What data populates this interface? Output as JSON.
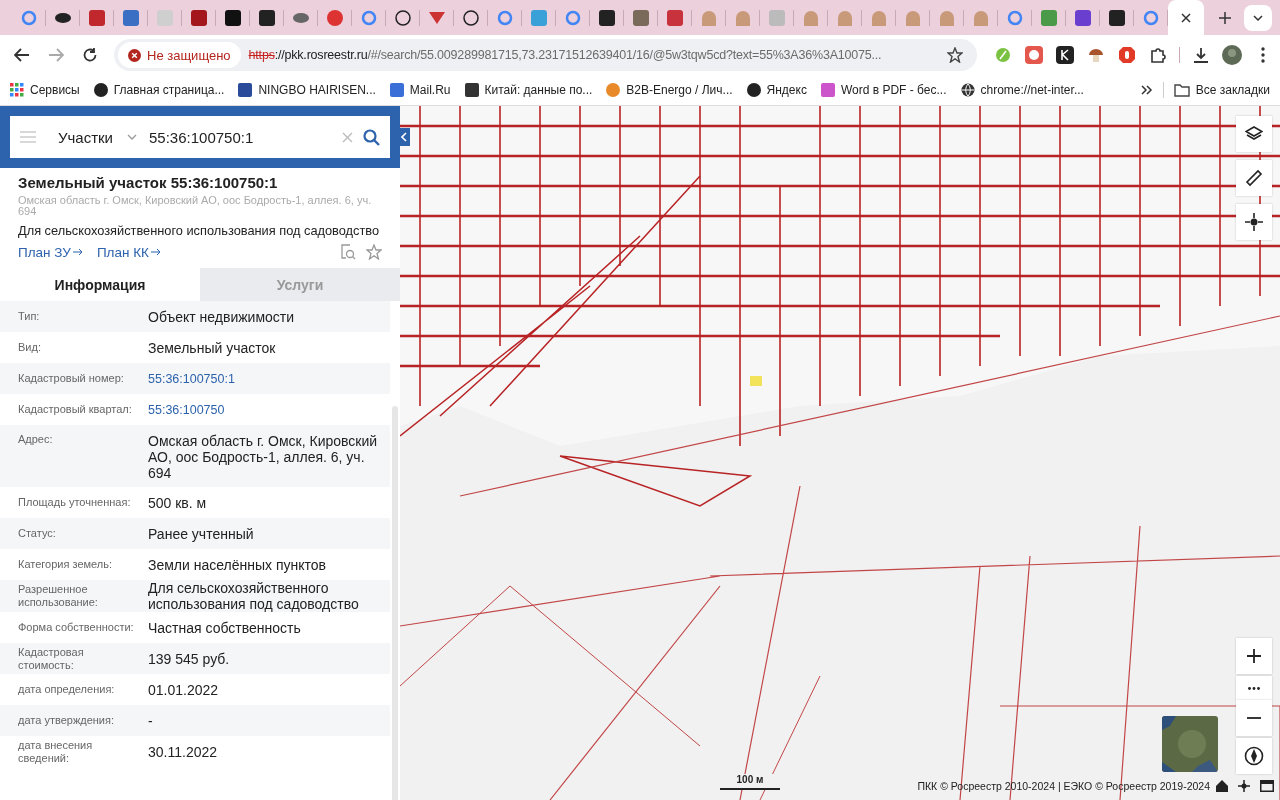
{
  "browser": {
    "tabs": [
      {
        "selected": false
      },
      {
        "selected": false
      },
      {
        "selected": false
      },
      {
        "selected": false
      },
      {
        "selected": false
      },
      {
        "selected": false
      },
      {
        "selected": false
      },
      {
        "selected": false
      },
      {
        "selected": false
      },
      {
        "selected": false
      },
      {
        "selected": false
      },
      {
        "selected": false
      },
      {
        "selected": false
      },
      {
        "selected": false
      },
      {
        "selected": false
      },
      {
        "selected": false
      },
      {
        "selected": false
      },
      {
        "selected": false
      },
      {
        "selected": false
      },
      {
        "selected": false
      },
      {
        "selected": false
      },
      {
        "selected": false
      },
      {
        "selected": false
      },
      {
        "selected": false
      },
      {
        "selected": false
      },
      {
        "selected": false
      },
      {
        "selected": false
      },
      {
        "selected": false
      },
      {
        "selected": false
      },
      {
        "selected": false
      },
      {
        "selected": false
      },
      {
        "selected": false
      },
      {
        "selected": false
      },
      {
        "selected": false
      },
      {
        "selected": true
      }
    ],
    "security_label": "Не защищено",
    "url": {
      "scheme": "https",
      "host": "://pkk.rosreestr.ru",
      "path": "/#/search/55.009289981715,73.23171512639401/16/@5w3tqw5cd?text=55%3A36%3A10075..."
    },
    "bookmarks": [
      {
        "label": "Сервисы"
      },
      {
        "label": "Главная страница..."
      },
      {
        "label": "NINGBO HAIRISEN..."
      },
      {
        "label": "Mail.Ru"
      },
      {
        "label": "Китай: данные по..."
      },
      {
        "label": "B2B-Energo / Лич..."
      },
      {
        "label": "Яндекс"
      },
      {
        "label": "Word в PDF - бес..."
      },
      {
        "label": "chrome://net-inter..."
      }
    ],
    "all_bookmarks": "Все закладки"
  },
  "search": {
    "category": "Участки",
    "value": "55:36:100750:1"
  },
  "parcel": {
    "title": "Земельный участок 55:36:100750:1",
    "address": "Омская область г. Омск, Кировский АО, оос Бодрость-1, аллея. 6, уч. 694",
    "purpose": "Для сельскохозяйственного использования под садоводство",
    "links": [
      "План ЗУ",
      "План КК"
    ]
  },
  "panel_tabs": [
    {
      "label": "Информация",
      "selected": true
    },
    {
      "label": "Услуги",
      "selected": false
    }
  ],
  "info_rows": [
    {
      "label": "Тип:",
      "value": "Объект недвижимости",
      "kind": "text"
    },
    {
      "label": "Вид:",
      "value": "Земельный участок",
      "kind": "text"
    },
    {
      "label": "Кадастровый номер:",
      "value": "55:36:100750:1",
      "kind": "link"
    },
    {
      "label": "Кадастровый квартал:",
      "value": "55:36:100750",
      "kind": "link"
    },
    {
      "label": "Адрес:",
      "value": "Омская область г. Омск, Кировский АО, оос Бодрость-1, аллея. 6, уч. 694",
      "kind": "text"
    },
    {
      "label": "Площадь уточненная:",
      "value": "500 кв. м",
      "kind": "text"
    },
    {
      "label": "Статус:",
      "value": "Ранее учтенный",
      "kind": "text"
    },
    {
      "label": "Категория земель:",
      "value": "Земли населённых пунктов",
      "kind": "text"
    },
    {
      "label": "Разрешенное использование:",
      "value": "Для сельскохозяйственного использования под садоводство",
      "kind": "text"
    },
    {
      "label": "Форма собственности:",
      "value": "Частная собственность",
      "kind": "text"
    },
    {
      "label": "Кадастровая стоимость:",
      "value": "139 545 руб.",
      "kind": "text"
    },
    {
      "label": "дата определения:",
      "value": "01.01.2022",
      "kind": "text"
    },
    {
      "label": "дата утверждения:",
      "value": "-",
      "kind": "text"
    },
    {
      "label": "дата внесения сведений:",
      "value": "30.11.2022",
      "kind": "text"
    }
  ],
  "map": {
    "scale": "100 м",
    "attribution": "ПКК © Росреестр 2010-2024 | ЕЭКО © Росреестр 2019-2024"
  }
}
